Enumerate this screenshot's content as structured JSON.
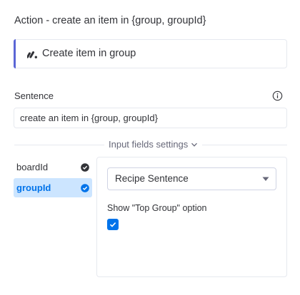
{
  "header": {
    "title": "Action - create an item in {group, groupId}"
  },
  "action_card": {
    "label": "Create item in group",
    "logo_icon": "monday-logo-icon",
    "accent_color": "#5b66d6"
  },
  "sentence": {
    "label": "Sentence",
    "value": "create an item in {group, groupId}",
    "info_icon": "info-icon"
  },
  "input_fields": {
    "toggle_label": "Input fields settings",
    "items": [
      {
        "label": "boardId",
        "selected": false,
        "icon": "check-circle-icon"
      },
      {
        "label": "groupId",
        "selected": true,
        "icon": "check-circle-icon"
      }
    ]
  },
  "settings": {
    "select_value": "Recipe Sentence",
    "option_label": "Show \"Top Group\" option",
    "option_checked": true,
    "accent_color": "#0073ea"
  }
}
